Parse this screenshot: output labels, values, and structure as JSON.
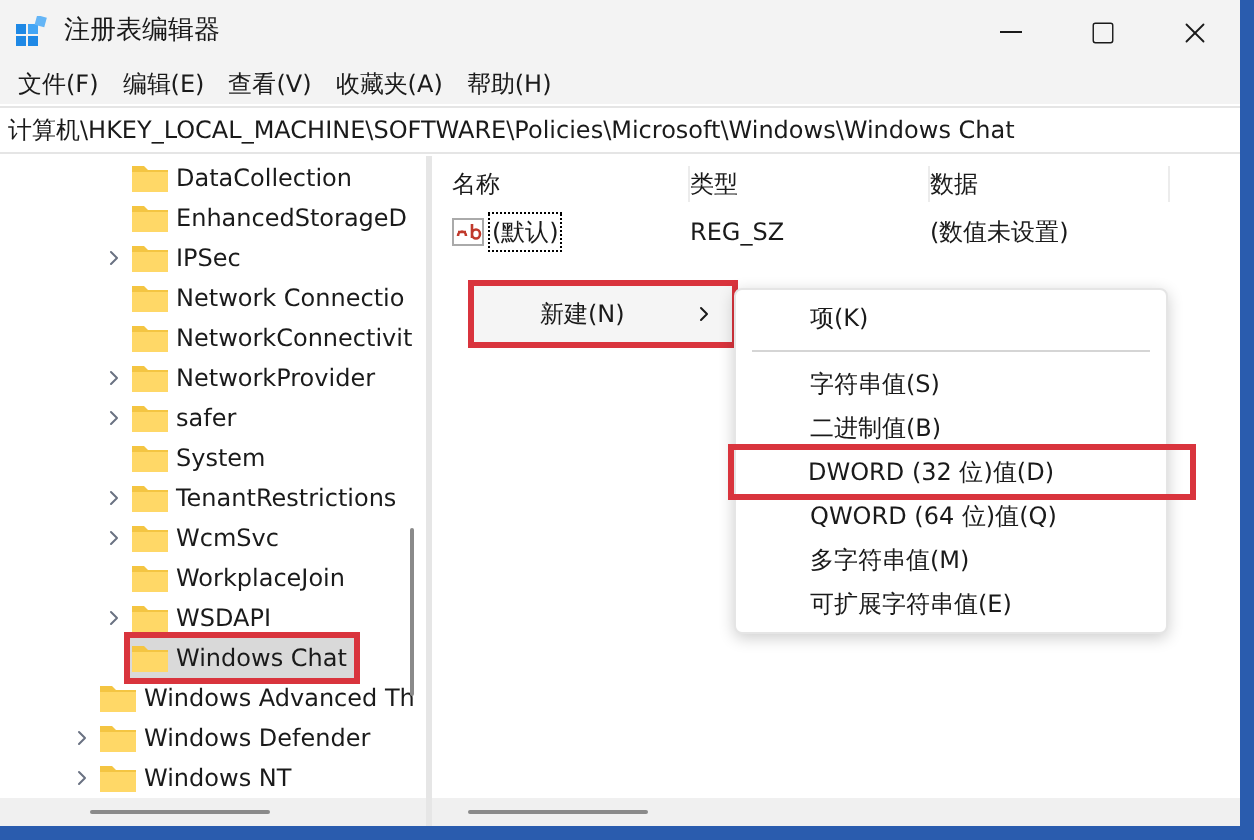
{
  "window": {
    "title": "注册表编辑器"
  },
  "menu": [
    "文件(F)",
    "编辑(E)",
    "查看(V)",
    "收藏夹(A)",
    "帮助(H)"
  ],
  "address": "计算机\\HKEY_LOCAL_MACHINE\\SOFTWARE\\Policies\\Microsoft\\Windows\\Windows Chat",
  "tree": {
    "nested_items": [
      {
        "label": "DataCollection",
        "expandable": false,
        "selected": false,
        "outlined": false
      },
      {
        "label": "EnhancedStorageD",
        "expandable": false,
        "selected": false,
        "outlined": false
      },
      {
        "label": "IPSec",
        "expandable": true,
        "selected": false,
        "outlined": false
      },
      {
        "label": "Network Connectio",
        "expandable": false,
        "selected": false,
        "outlined": false
      },
      {
        "label": "NetworkConnectivit",
        "expandable": false,
        "selected": false,
        "outlined": false
      },
      {
        "label": "NetworkProvider",
        "expandable": true,
        "selected": false,
        "outlined": false
      },
      {
        "label": "safer",
        "expandable": true,
        "selected": false,
        "outlined": false
      },
      {
        "label": "System",
        "expandable": false,
        "selected": false,
        "outlined": false
      },
      {
        "label": "TenantRestrictions",
        "expandable": true,
        "selected": false,
        "outlined": false
      },
      {
        "label": "WcmSvc",
        "expandable": true,
        "selected": false,
        "outlined": false
      },
      {
        "label": "WorkplaceJoin",
        "expandable": false,
        "selected": false,
        "outlined": false
      },
      {
        "label": "WSDAPI",
        "expandable": true,
        "selected": false,
        "outlined": false
      },
      {
        "label": "Windows Chat",
        "expandable": false,
        "selected": true,
        "outlined": true
      }
    ],
    "items": [
      {
        "label": "Windows Advanced Th",
        "expandable": false,
        "selected": false,
        "outlined": false
      },
      {
        "label": "Windows Defender",
        "expandable": true,
        "selected": false,
        "outlined": false
      },
      {
        "label": "Windows NT",
        "expandable": true,
        "selected": false,
        "outlined": false
      }
    ]
  },
  "list": {
    "columns": [
      "名称",
      "类型",
      "数据"
    ],
    "rows": [
      {
        "name": "(默认)",
        "type": "REG_SZ",
        "data": "(数值未设置)"
      }
    ]
  },
  "context_menu": {
    "label": "新建(N)",
    "outlined": true
  },
  "submenu": [
    {
      "kind": "item",
      "label": "项(K)",
      "outlined": false
    },
    {
      "kind": "separator"
    },
    {
      "kind": "item",
      "label": "字符串值(S)",
      "outlined": false
    },
    {
      "kind": "item",
      "label": "二进制值(B)",
      "outlined": false
    },
    {
      "kind": "item",
      "label": "DWORD (32 位)值(D)",
      "outlined": true
    },
    {
      "kind": "item",
      "label": "QWORD (64 位)值(Q)",
      "outlined": false
    },
    {
      "kind": "item",
      "label": "多字符串值(M)",
      "outlined": false
    },
    {
      "kind": "item",
      "label": "可扩展字符串值(E)",
      "outlined": false
    }
  ]
}
